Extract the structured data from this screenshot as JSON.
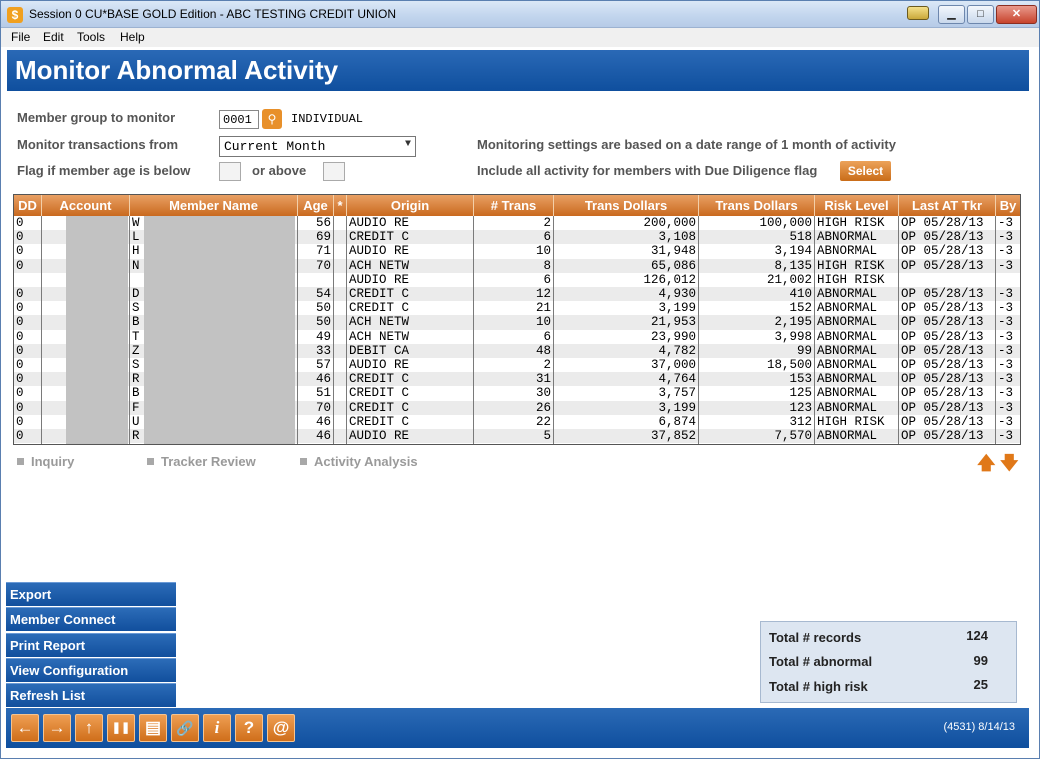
{
  "window": {
    "title": "Session 0 CU*BASE GOLD Edition - ABC TESTING CREDIT UNION",
    "min_symbol": "▁",
    "max_symbol": "□",
    "close_symbol": "✕"
  },
  "menu": [
    "File",
    "Edit",
    "Tools",
    "Help"
  ],
  "page": {
    "title": "Monitor Abnormal Activity"
  },
  "filters": {
    "group_label": "Member group to monitor",
    "group_code": "0001",
    "group_name": "INDIVIDUAL",
    "from_label": "Monitor transactions from",
    "range_value": "Current Month",
    "age_label": "Flag if member age is below",
    "or_above_label": "or above",
    "settings_text": "Monitoring settings are based on a date range of 1 month of activity",
    "diligence_text": "Include all activity for members with Due Diligence flag",
    "select_label": "Select"
  },
  "table": {
    "columns": [
      "DD",
      "Account",
      "Member Name",
      "Age",
      "*",
      "Origin",
      "# Trans",
      "Trans Dollars",
      "Trans Dollars",
      "Risk Level",
      "Last AT Tkr",
      "By"
    ],
    "rows": [
      {
        "dd": "0",
        "name": "W",
        "age": "56",
        "origin": "AUDIO RE",
        "trans": "2",
        "dollars": "200,000",
        "dollars2": "100,000",
        "risk": "HIGH RISK",
        "last": "OP 05/28/13",
        "by": "-3"
      },
      {
        "dd": "0",
        "name": "L",
        "age": "69",
        "origin": "CREDIT C",
        "trans": "6",
        "dollars": "3,108",
        "dollars2": "518",
        "risk": "ABNORMAL",
        "last": "OP 05/28/13",
        "by": "-3"
      },
      {
        "dd": "0",
        "name": "H",
        "age": "71",
        "origin": "AUDIO RE",
        "trans": "10",
        "dollars": "31,948",
        "dollars2": "3,194",
        "risk": "ABNORMAL",
        "last": "OP 05/28/13",
        "by": "-3"
      },
      {
        "dd": "0",
        "name": "N",
        "age": "70",
        "origin": "ACH NETW",
        "trans": "8",
        "dollars": "65,086",
        "dollars2": "8,135",
        "risk": "HIGH RISK",
        "last": "OP 05/28/13",
        "by": "-3"
      },
      {
        "dd": "",
        "name": "",
        "age": "",
        "origin": "AUDIO RE",
        "trans": "6",
        "dollars": "126,012",
        "dollars2": "21,002",
        "risk": "HIGH RISK",
        "last": "",
        "by": ""
      },
      {
        "dd": "0",
        "name": "D",
        "age": "54",
        "origin": "CREDIT C",
        "trans": "12",
        "dollars": "4,930",
        "dollars2": "410",
        "risk": "ABNORMAL",
        "last": "OP 05/28/13",
        "by": "-3"
      },
      {
        "dd": "0",
        "name": "S",
        "age": "50",
        "origin": "CREDIT C",
        "trans": "21",
        "dollars": "3,199",
        "dollars2": "152",
        "risk": "ABNORMAL",
        "last": "OP 05/28/13",
        "by": "-3"
      },
      {
        "dd": "0",
        "name": "B",
        "age": "50",
        "origin": "ACH NETW",
        "trans": "10",
        "dollars": "21,953",
        "dollars2": "2,195",
        "risk": "ABNORMAL",
        "last": "OP 05/28/13",
        "by": "-3"
      },
      {
        "dd": "0",
        "name": "T",
        "age": "49",
        "origin": "ACH NETW",
        "trans": "6",
        "dollars": "23,990",
        "dollars2": "3,998",
        "risk": "ABNORMAL",
        "last": "OP 05/28/13",
        "by": "-3"
      },
      {
        "dd": "0",
        "name": "Z",
        "age": "33",
        "origin": "DEBIT CA",
        "trans": "48",
        "dollars": "4,782",
        "dollars2": "99",
        "risk": "ABNORMAL",
        "last": "OP 05/28/13",
        "by": "-3"
      },
      {
        "dd": "0",
        "name": "S",
        "age": "57",
        "origin": "AUDIO RE",
        "trans": "2",
        "dollars": "37,000",
        "dollars2": "18,500",
        "risk": "ABNORMAL",
        "last": "OP 05/28/13",
        "by": "-3"
      },
      {
        "dd": "0",
        "name": "R",
        "age": "46",
        "origin": "CREDIT C",
        "trans": "31",
        "dollars": "4,764",
        "dollars2": "153",
        "risk": "ABNORMAL",
        "last": "OP 05/28/13",
        "by": "-3"
      },
      {
        "dd": "0",
        "name": "B",
        "age": "51",
        "origin": "CREDIT C",
        "trans": "30",
        "dollars": "3,757",
        "dollars2": "125",
        "risk": "ABNORMAL",
        "last": "OP 05/28/13",
        "by": "-3"
      },
      {
        "dd": "0",
        "name": "F",
        "age": "70",
        "origin": "CREDIT C",
        "trans": "26",
        "dollars": "3,199",
        "dollars2": "123",
        "risk": "ABNORMAL",
        "last": "OP 05/28/13",
        "by": "-3"
      },
      {
        "dd": "0",
        "name": "U",
        "age": "46",
        "origin": "CREDIT C",
        "trans": "22",
        "dollars": "6,874",
        "dollars2": "312",
        "risk": "HIGH RISK",
        "last": "OP 05/28/13",
        "by": "-3"
      },
      {
        "dd": "0",
        "name": "R",
        "age": "46",
        "origin": "AUDIO RE",
        "trans": "5",
        "dollars": "37,852",
        "dollars2": "7,570",
        "risk": "ABNORMAL",
        "last": "OP 05/28/13",
        "by": "-3"
      }
    ]
  },
  "links": [
    "Inquiry",
    "Tracker Review",
    "Activity Analysis"
  ],
  "scroll": {
    "up": "🡅",
    "down": "🡇"
  },
  "actions": [
    "Export",
    "Member Connect",
    "Print Report",
    "View Configuration",
    "Refresh List"
  ],
  "totals": [
    {
      "label": "Total # records",
      "value": "124"
    },
    {
      "label": "Total # abnormal",
      "value": "99"
    },
    {
      "label": "Total # high risk",
      "value": "25"
    }
  ],
  "toolbar": [
    {
      "name": "back-icon",
      "glyph": "←"
    },
    {
      "name": "forward-icon",
      "glyph": "→"
    },
    {
      "name": "up-icon",
      "glyph": "↑"
    },
    {
      "name": "pause-icon",
      "glyph": "❚❚"
    },
    {
      "name": "print-icon",
      "glyph": "▤"
    },
    {
      "name": "link-icon",
      "glyph": "🔗"
    },
    {
      "name": "info-icon",
      "glyph": "i"
    },
    {
      "name": "help-icon",
      "glyph": "?"
    },
    {
      "name": "email-icon",
      "glyph": "@"
    }
  ],
  "status": "(4531) 8/14/13"
}
